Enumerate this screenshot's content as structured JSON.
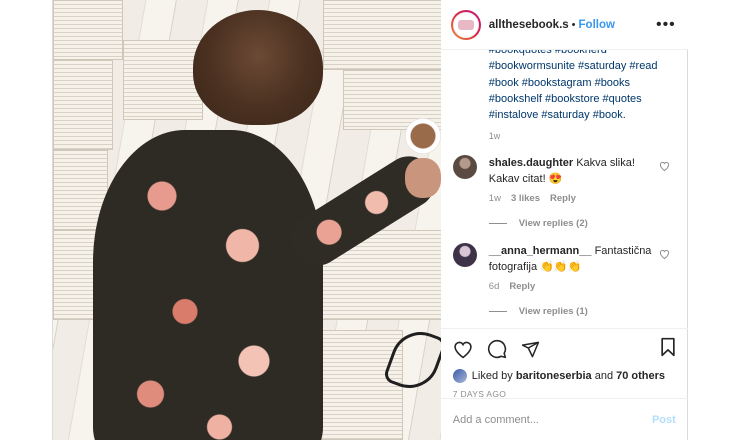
{
  "header": {
    "username": "allthesebook.s",
    "separator": "•",
    "follow_label": "Follow",
    "more_label": "•••"
  },
  "caption": {
    "text": "#bookquotes #booknerd #bookwormsunite #saturday #read #book #bookstagram #books #bookshelf #bookstore #quotes #instalove #saturday #book.",
    "time": "1w"
  },
  "comments": [
    {
      "username": "shales.daughter",
      "text": "Kakva slika! Kakav citat! 😍",
      "time": "1w",
      "likes": "3 likes",
      "reply_label": "Reply",
      "view_replies": "View replies (2)",
      "avatar_color": "#6a5a52"
    },
    {
      "username": "__anna_hermann__",
      "text": "Fantastična fotografija 👏👏👏",
      "time": "6d",
      "likes": "",
      "reply_label": "Reply",
      "view_replies": "View replies (1)",
      "avatar_color": "#4b3f55"
    }
  ],
  "actions": {
    "like_icon": "heart-icon",
    "comment_icon": "comment-icon",
    "share_icon": "share-icon",
    "save_icon": "bookmark-icon"
  },
  "likes": {
    "prefix": "Liked by",
    "user": "baritoneserbia",
    "conj": "and",
    "others": "70 others"
  },
  "date": "7 DAYS AGO",
  "add_comment": {
    "placeholder": "Add a comment...",
    "post_label": "Post"
  },
  "colors": {
    "link": "#00376b",
    "follow": "#3897f0",
    "post_disabled": "#b2dffc",
    "muted": "#8e8e8e"
  }
}
